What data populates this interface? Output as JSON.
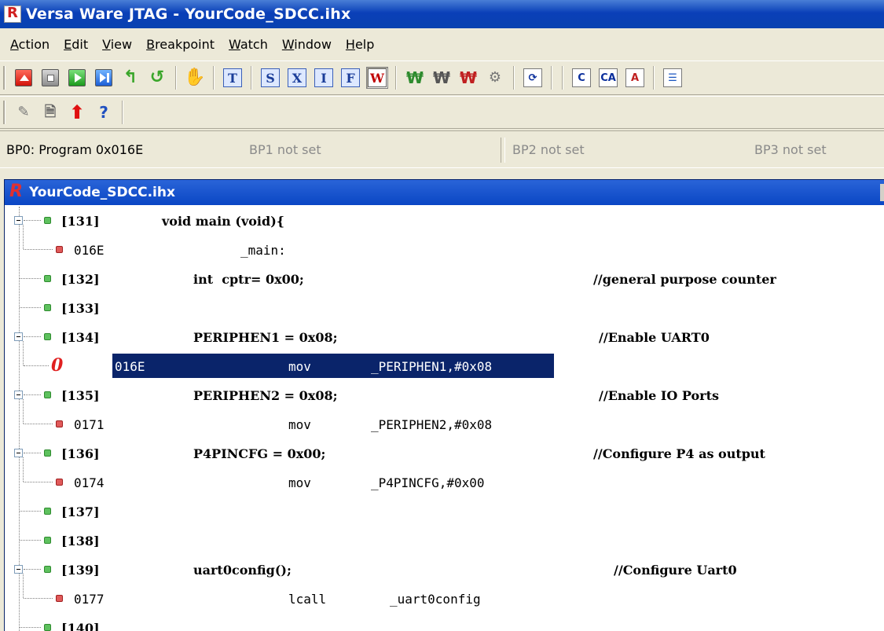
{
  "window": {
    "title": "Versa Ware JTAG - YourCode_SDCC.ihx"
  },
  "menu": [
    "Action",
    "Edit",
    "View",
    "Breakpoint",
    "Watch",
    "Window",
    "Help"
  ],
  "toolbar": {
    "buttons_row1": [
      "stop-square-red",
      "stop-square-gray",
      "run-green",
      "step-blue",
      "reset-arrow",
      "return-arrow",
      "hand-icon",
      "T",
      "S",
      "X",
      "I",
      "F",
      "W",
      "watch-icons",
      "refresh",
      "C",
      "CA",
      "A"
    ],
    "boxes": {
      "t": "T",
      "s": "S",
      "x": "X",
      "i": "I",
      "f": "F",
      "w": "W"
    }
  },
  "breakpoints": {
    "bp0": "BP0: Program 0x016E",
    "bp1": "BP1 not set",
    "bp2": "BP2 not set",
    "bp3": "BP3 not set"
  },
  "code_window": {
    "title": "YourCode_SDCC.ihx",
    "rows": [
      {
        "line": "[131]",
        "code": "void main (void){",
        "comment": ""
      },
      {
        "addr": "016E",
        "code": "_main:"
      },
      {
        "line": "[132]",
        "code": "int  cptr= 0x00;",
        "comment": "//general purpose counter"
      },
      {
        "line": "[133]",
        "code": "",
        "comment": ""
      },
      {
        "line": "[134]",
        "code": "PERIPHEN1 = 0x08;",
        "comment": "//Enable UART0"
      },
      {
        "addr": "016E",
        "mnemonic": "mov",
        "operands": "_PERIPHEN1,#0x08",
        "breakpoint_label": "0"
      },
      {
        "line": "[135]",
        "code": "PERIPHEN2 = 0x08;",
        "comment": "//Enable IO Ports"
      },
      {
        "addr": "0171",
        "mnemonic": "mov",
        "operands": "_PERIPHEN2,#0x08"
      },
      {
        "line": "[136]",
        "code": "P4PINCFG = 0x00;",
        "comment": "//Configure P4 as output"
      },
      {
        "addr": "0174",
        "mnemonic": "mov",
        "operands": "_P4PINCFG,#0x00"
      },
      {
        "line": "[137]",
        "code": "",
        "comment": ""
      },
      {
        "line": "[138]",
        "code": "",
        "comment": ""
      },
      {
        "line": "[139]",
        "code": "uart0config();",
        "comment": "//Configure Uart0"
      },
      {
        "addr": "0177",
        "mnemonic": "lcall",
        "operands": "_uart0config"
      },
      {
        "line": "[140]",
        "code": "",
        "comment": ""
      }
    ]
  },
  "colors": {
    "selection": "#0a246a",
    "title_blue": "#0a46c4",
    "breakpoint_red": "#e02020"
  }
}
